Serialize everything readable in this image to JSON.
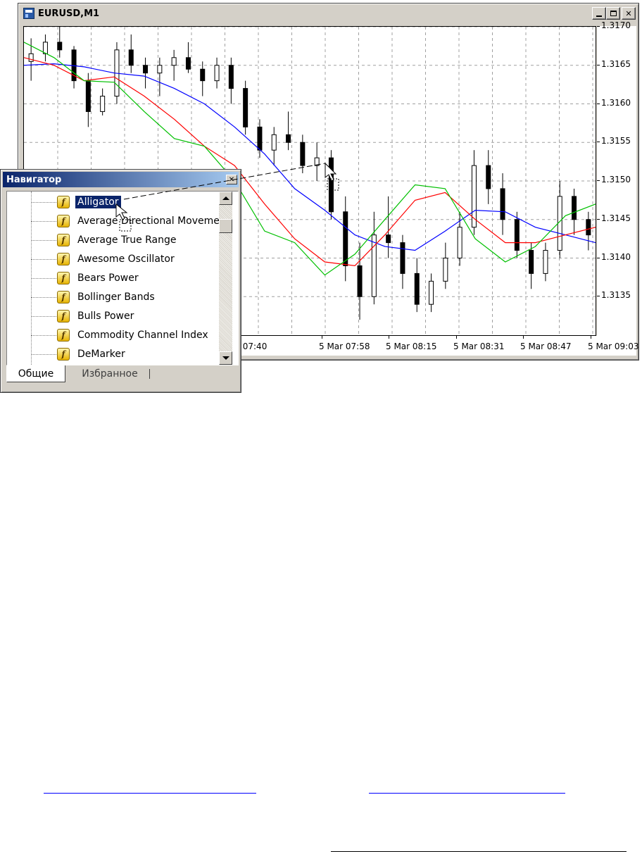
{
  "window": {
    "title": "EURUSD,M1",
    "controls": {
      "minimize": "_",
      "maximize": "□",
      "close": "✕"
    }
  },
  "price_axis": {
    "labels": [
      "1.3170",
      "1.3165",
      "1.3160",
      "1.3155",
      "1.3150",
      "1.3145",
      "1.3140",
      "1.3135"
    ]
  },
  "time_axis": {
    "labels": [
      "r 07:40",
      "5 Mar 07:58",
      "5 Mar 08:15",
      "5 Mar 08:31",
      "5 Mar 08:47",
      "5 Mar 09:03"
    ]
  },
  "chart_data": {
    "type": "line",
    "symbol": "EURUSD,M1",
    "ylim": [
      1.313,
      1.317
    ],
    "grid": true,
    "x": [
      "07:33",
      "07:38",
      "07:43",
      "07:48",
      "07:53",
      "07:58",
      "08:03",
      "08:08",
      "08:13",
      "08:18",
      "08:23",
      "08:28",
      "08:33",
      "08:38",
      "08:43",
      "08:48",
      "08:53",
      "08:58",
      "09:03",
      "09:08"
    ],
    "series": [
      {
        "color": "#0000ff",
        "values": [
          1.3165,
          1.31652,
          1.31648,
          1.3164,
          1.31636,
          1.3162,
          1.316,
          1.3157,
          1.31535,
          1.3149,
          1.31462,
          1.3143,
          1.31415,
          1.3141,
          1.31435,
          1.31462,
          1.3146,
          1.3144,
          1.3143,
          1.3142
        ]
      },
      {
        "color": "#ff0000",
        "values": [
          1.3166,
          1.3165,
          1.3163,
          1.31635,
          1.3161,
          1.3158,
          1.31545,
          1.3152,
          1.3147,
          1.31425,
          1.31395,
          1.3139,
          1.3143,
          1.31475,
          1.31485,
          1.3145,
          1.3142,
          1.3142,
          1.3143,
          1.3144
        ]
      },
      {
        "color": "#00c000",
        "values": [
          1.3168,
          1.3166,
          1.3163,
          1.31628,
          1.3159,
          1.31555,
          1.31545,
          1.315,
          1.31435,
          1.3142,
          1.31378,
          1.31405,
          1.3145,
          1.31495,
          1.3149,
          1.31425,
          1.31395,
          1.31415,
          1.31455,
          1.3147
        ]
      }
    ],
    "candles": [
      [
        1.31655,
        1.31685,
        1.3163,
        1.31665
      ],
      [
        1.31665,
        1.3169,
        1.31655,
        1.3168
      ],
      [
        1.3168,
        1.317,
        1.3166,
        1.3167
      ],
      [
        1.3167,
        1.31675,
        1.3162,
        1.3163
      ],
      [
        1.3163,
        1.3164,
        1.3157,
        1.3159
      ],
      [
        1.3159,
        1.3162,
        1.31585,
        1.3161
      ],
      [
        1.3161,
        1.3168,
        1.316,
        1.3167
      ],
      [
        1.3167,
        1.3169,
        1.3164,
        1.3165
      ],
      [
        1.3165,
        1.3166,
        1.3162,
        1.3164
      ],
      [
        1.3164,
        1.3166,
        1.3161,
        1.3165
      ],
      [
        1.3165,
        1.3167,
        1.3163,
        1.3166
      ],
      [
        1.3166,
        1.3168,
        1.3164,
        1.31645
      ],
      [
        1.31645,
        1.31655,
        1.3161,
        1.3163
      ],
      [
        1.3163,
        1.3166,
        1.3162,
        1.3165
      ],
      [
        1.3165,
        1.3166,
        1.316,
        1.3162
      ],
      [
        1.3162,
        1.3163,
        1.3156,
        1.3157
      ],
      [
        1.3157,
        1.3158,
        1.3153,
        1.3154
      ],
      [
        1.3154,
        1.3157,
        1.3152,
        1.3156
      ],
      [
        1.3156,
        1.3159,
        1.3154,
        1.3155
      ],
      [
        1.3155,
        1.3156,
        1.3151,
        1.3152
      ],
      [
        1.3152,
        1.3155,
        1.315,
        1.3153
      ],
      [
        1.3153,
        1.3154,
        1.3145,
        1.3146
      ],
      [
        1.3146,
        1.3148,
        1.3137,
        1.3139
      ],
      [
        1.3139,
        1.3142,
        1.3132,
        1.3135
      ],
      [
        1.3135,
        1.3146,
        1.3134,
        1.3143
      ],
      [
        1.3143,
        1.3148,
        1.314,
        1.3142
      ],
      [
        1.3142,
        1.3143,
        1.3136,
        1.3138
      ],
      [
        1.3138,
        1.314,
        1.3133,
        1.3134
      ],
      [
        1.3134,
        1.3138,
        1.3133,
        1.3137
      ],
      [
        1.3137,
        1.3142,
        1.3136,
        1.314
      ],
      [
        1.314,
        1.3146,
        1.3139,
        1.3144
      ],
      [
        1.3144,
        1.3154,
        1.3143,
        1.3152
      ],
      [
        1.3152,
        1.3154,
        1.3147,
        1.3149
      ],
      [
        1.3149,
        1.3151,
        1.3143,
        1.3145
      ],
      [
        1.3145,
        1.3146,
        1.314,
        1.3141
      ],
      [
        1.3141,
        1.3142,
        1.3136,
        1.3138
      ],
      [
        1.3138,
        1.3142,
        1.3137,
        1.3141
      ],
      [
        1.3141,
        1.315,
        1.314,
        1.3148
      ],
      [
        1.3148,
        1.3149,
        1.3143,
        1.3145
      ],
      [
        1.3145,
        1.3146,
        1.3141,
        1.3143
      ]
    ]
  },
  "navigator": {
    "title": "Навигатор",
    "close": "✕",
    "items": [
      {
        "label": "Alligator"
      },
      {
        "label": "Average Directional Moveme"
      },
      {
        "label": "Average True Range"
      },
      {
        "label": "Awesome Oscillator"
      },
      {
        "label": "Bears Power"
      },
      {
        "label": "Bollinger Bands"
      },
      {
        "label": "Bulls Power"
      },
      {
        "label": "Commodity Channel Index"
      },
      {
        "label": "DeMarker"
      }
    ],
    "item_icon": "fx-icon",
    "tabs": [
      {
        "label": "Общие"
      },
      {
        "label": "Избранное"
      }
    ]
  },
  "colors": {
    "selection": "#0a246a",
    "link_line": "#0000ff"
  }
}
